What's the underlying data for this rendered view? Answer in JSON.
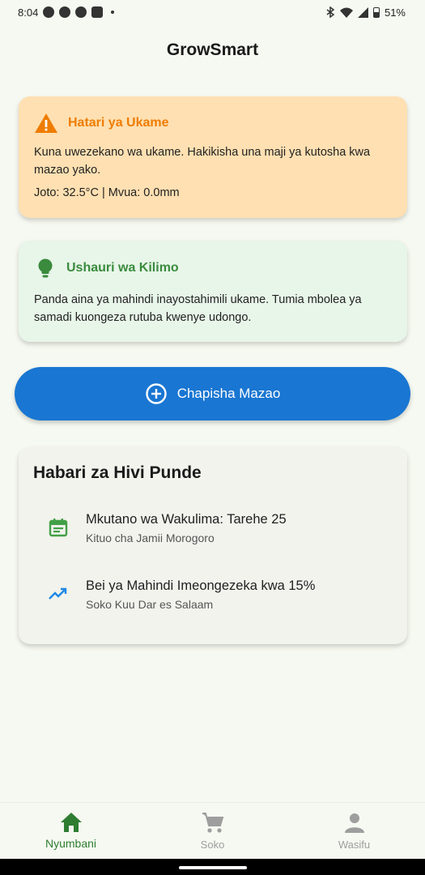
{
  "status_bar": {
    "time": "8:04",
    "battery": "51%",
    "icons_left": [
      "message-icon",
      "whatsapp-icon",
      "telegram-icon",
      "youtube-icon"
    ],
    "icons_right": [
      "bluetooth-icon",
      "wifi-icon",
      "signal-icon",
      "battery-icon"
    ]
  },
  "app": {
    "title": "GrowSmart"
  },
  "alert": {
    "title": "Hatari ya Ukame",
    "body": "Kuna uwezekano wa ukame. Hakikisha una maji ya kutosha kwa mazao yako.",
    "meta": "Joto: 32.5°C | Mvua: 0.0mm",
    "icon": "warning-icon",
    "accent": "#ef7c00",
    "background": "#ffe0b2"
  },
  "tip": {
    "title": "Ushauri wa Kilimo",
    "body": "Panda aina ya mahindi inayostahimili ukame. Tumia mbolea ya samadi kuongeza rutuba kwenye udongo.",
    "icon": "lightbulb-icon",
    "accent": "#3a8b3d",
    "background": "#e8f5e9"
  },
  "primary_action": {
    "label": "Chapisha Mazao",
    "icon": "add-circle-icon",
    "color": "#1976d2"
  },
  "news": {
    "title": "Habari za Hivi Punde",
    "items": [
      {
        "title": "Mkutano wa Wakulima: Tarehe 25",
        "subtitle": "Kituo cha Jamii Morogoro",
        "icon": "calendar-icon",
        "icon_color": "#43a047"
      },
      {
        "title": "Bei ya Mahindi Imeongezeka kwa 15%",
        "subtitle": "Soko Kuu Dar es Salaam",
        "icon": "trending-up-icon",
        "icon_color": "#1e88e5"
      }
    ]
  },
  "bottom_nav": {
    "items": [
      {
        "label": "Nyumbani",
        "icon": "home-icon",
        "active": true
      },
      {
        "label": "Soko",
        "icon": "cart-icon",
        "active": false
      },
      {
        "label": "Wasifu",
        "icon": "person-icon",
        "active": false
      }
    ],
    "active_color": "#2e7d32"
  }
}
